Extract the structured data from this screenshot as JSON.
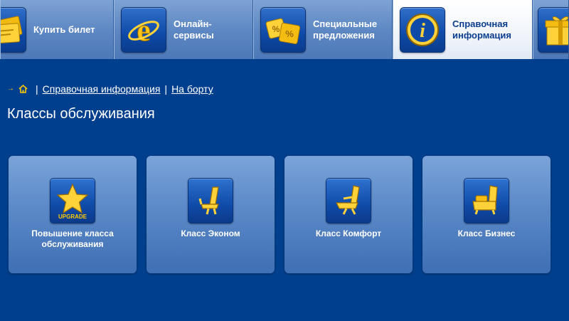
{
  "nav": {
    "tabs": [
      {
        "label": "Купить билет",
        "icon": "tickets-icon",
        "active": false
      },
      {
        "label": "Онлайн-\nсервисы",
        "icon": "internet-explorer-icon",
        "active": false
      },
      {
        "label": "Специальные\nпредложения",
        "icon": "discount-dice-icon",
        "active": false
      },
      {
        "label": "Справочная\nинформация",
        "icon": "info-icon",
        "active": true
      },
      {
        "label": "",
        "icon": "gift-box-icon",
        "active": false
      }
    ]
  },
  "breadcrumb": {
    "items": [
      "Справочная информация",
      "На борту"
    ],
    "separator": "|"
  },
  "page": {
    "title": "Классы обслуживания"
  },
  "cards": [
    {
      "label": "Повышение класса\nобслуживания",
      "icon": "upgrade-star-icon",
      "icon_text": "UPGRADE"
    },
    {
      "label": "Класс Эконом",
      "icon": "economy-seat-icon"
    },
    {
      "label": "Класс Комфорт",
      "icon": "comfort-seat-icon"
    },
    {
      "label": "Класс Бизнес",
      "icon": "business-seat-icon"
    }
  ],
  "colors": {
    "background": "#003f8e",
    "accent": "#ffcc00",
    "active_tab_text": "#0b3e8f"
  }
}
